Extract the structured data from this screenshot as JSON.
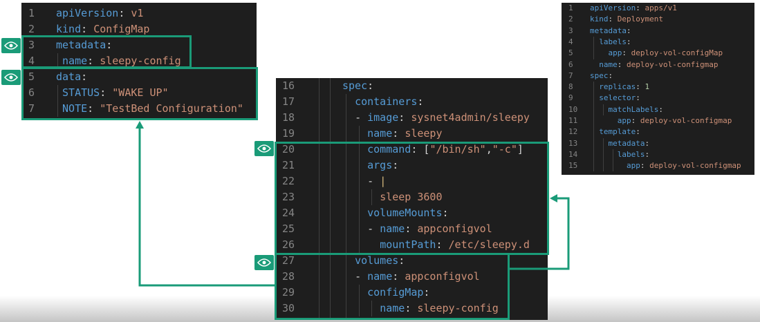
{
  "configmap_panel": {
    "lines": [
      {
        "num": "1",
        "text": "apiVersion: v1"
      },
      {
        "num": "2",
        "text": "kind: ConfigMap"
      },
      {
        "num": "3",
        "text": "metadata:"
      },
      {
        "num": "4",
        "text": " name: sleepy-config"
      },
      {
        "num": "5",
        "text": "data:"
      },
      {
        "num": "6",
        "text": " STATUS: \"WAKE UP\""
      },
      {
        "num": "7",
        "text": " NOTE: \"TestBed Configuration\""
      }
    ]
  },
  "pod_spec_panel": {
    "lines": [
      {
        "num": "16",
        "text": "spec:"
      },
      {
        "num": "17",
        "text": "  containers:"
      },
      {
        "num": "18",
        "text": "  - image: sysnet4admin/sleepy"
      },
      {
        "num": "19",
        "text": "    name: sleepy"
      },
      {
        "num": "20",
        "text": "    command: [\"/bin/sh\",\"-c\"]"
      },
      {
        "num": "21",
        "text": "    args:"
      },
      {
        "num": "22",
        "text": "    - |"
      },
      {
        "num": "23",
        "text": "      sleep 3600"
      },
      {
        "num": "24",
        "text": "    volumeMounts:"
      },
      {
        "num": "25",
        "text": "    - name: appconfigvol"
      },
      {
        "num": "26",
        "text": "      mountPath: /etc/sleepy.d"
      },
      {
        "num": "27",
        "text": "  volumes:"
      },
      {
        "num": "28",
        "text": "  - name: appconfigvol"
      },
      {
        "num": "29",
        "text": "    configMap:"
      },
      {
        "num": "30",
        "text": "      name: sleepy-config"
      }
    ]
  },
  "deployment_panel": {
    "lines": [
      {
        "num": "1",
        "text": "apiVersion: apps/v1"
      },
      {
        "num": "2",
        "text": "kind: Deployment"
      },
      {
        "num": "3",
        "text": "metadata:"
      },
      {
        "num": "4",
        "text": "  labels:"
      },
      {
        "num": "5",
        "text": "    app: deploy-vol-configMap"
      },
      {
        "num": "6",
        "text": "  name: deploy-vol-configmap"
      },
      {
        "num": "7",
        "text": "spec:"
      },
      {
        "num": "8",
        "text": "  replicas: 1"
      },
      {
        "num": "9",
        "text": "  selector:"
      },
      {
        "num": "10",
        "text": "    matchLabels:"
      },
      {
        "num": "11",
        "text": "      app: deploy-vol-configmap"
      },
      {
        "num": "12",
        "text": "  template:"
      },
      {
        "num": "13",
        "text": "    metadata:"
      },
      {
        "num": "14",
        "text": "      labels:"
      },
      {
        "num": "15",
        "text": "        app: deploy-vol-configmap"
      }
    ]
  },
  "highlights": {
    "color": "#1a9b78",
    "badge_icon": "eye-icon"
  },
  "colors": {
    "key": "#569cd6",
    "string_value": "#ce9178",
    "number": "#b5cea8",
    "line_number": "#858585",
    "editor_bg": "#1e1e1e"
  }
}
